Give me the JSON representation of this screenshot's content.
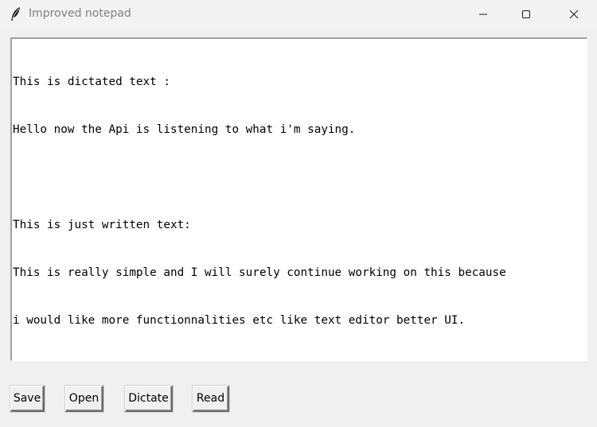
{
  "window": {
    "title": "Improved notepad",
    "icon": "feather-icon"
  },
  "controls": {
    "minimize_icon": "minimize-icon",
    "maximize_icon": "maximize-icon",
    "close_icon": "close-icon"
  },
  "editor": {
    "lines": [
      "This is dictated text :",
      "Hello now the Api is listening to what i'm saying.",
      "",
      "This is just written text:",
      "This is really simple and I will surely continue working on this because",
      "i would like more functionnalities etc like text editor better UI."
    ]
  },
  "buttons": {
    "save": "Save",
    "open": "Open",
    "dictate": "Dictate",
    "read": "Read"
  }
}
